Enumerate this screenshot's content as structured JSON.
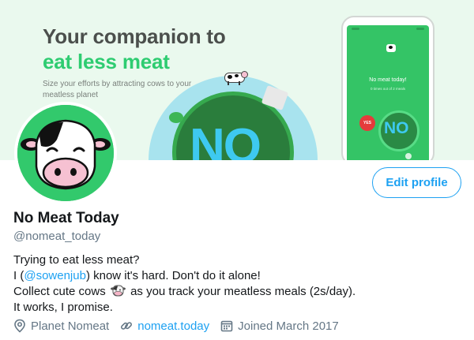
{
  "banner": {
    "headline_line1": "Your companion to",
    "headline_line2": "eat less meat",
    "tagline": "Size your efforts by attracting cows to your meatless planet",
    "planet_text": "NO",
    "phone": {
      "title": "No meat today!",
      "subtitle": "0 times out of 2 meals",
      "yes_label": "YES",
      "no_label": "NO"
    },
    "colors": {
      "background": "#eaf9ee",
      "accent_green": "#2ecc71",
      "planet": "#2a7d3c",
      "sky": "#a8e3ee"
    }
  },
  "profile": {
    "display_name": "No Meat Today",
    "handle": "@nomeat_today",
    "edit_button_label": "Edit profile",
    "bio": {
      "line1": "Trying to eat less meat?",
      "line2_prefix": "I (",
      "line2_mention": "@sowenjub",
      "line2_suffix": ") know it's hard. Don't do it alone!",
      "line3_prefix": "Collect cute cows",
      "line3_suffix": "as you track your meatless meals (2s/day).",
      "line4": "It works, I promise."
    },
    "meta": {
      "location": "Planet Nomeat",
      "website": "nomeat.today",
      "joined": "Joined March 2017"
    },
    "icons": {
      "location": "location-pin-icon",
      "website": "link-icon",
      "joined": "calendar-icon",
      "bio_emoji": "cow-face-icon"
    },
    "colors": {
      "link": "#1da1f2",
      "muted": "#657786",
      "text": "#14171a",
      "avatar_bg": "#32c96c"
    }
  }
}
